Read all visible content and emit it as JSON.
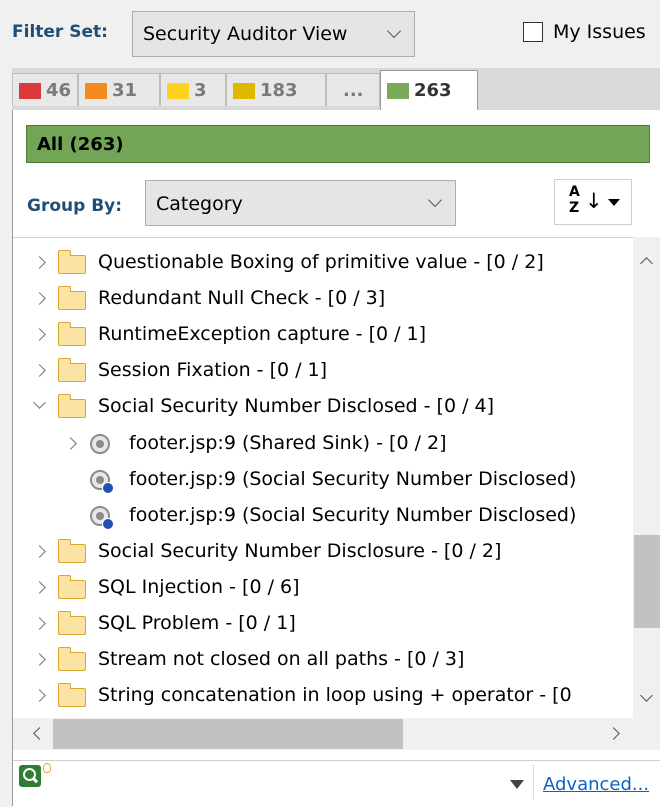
{
  "filter_set": {
    "label": "Filter Set:",
    "value": "Security Auditor View"
  },
  "my_issues": {
    "label": "My Issues",
    "checked": false
  },
  "tabs": [
    {
      "count": "46",
      "color": "#d93b3b"
    },
    {
      "count": "31",
      "color": "#f28c1e"
    },
    {
      "count": "3",
      "color": "#ffd21f"
    },
    {
      "count": "183",
      "color": "#e0b800"
    },
    {
      "count": "..."
    },
    {
      "count": "263",
      "color": "#7aaa5a",
      "active": true
    }
  ],
  "all_bar": {
    "label": "All (263)",
    "color": "#73a557"
  },
  "group_by": {
    "label": "Group By:",
    "value": "Category"
  },
  "sort": {
    "az": "A\nZ",
    "arrow": "↓"
  },
  "tree": [
    {
      "type": "folder",
      "expanded": false,
      "text": "Questionable Boxing of primitive value - [0 / 2]"
    },
    {
      "type": "folder",
      "expanded": false,
      "text": "Redundant Null Check - [0 / 3]"
    },
    {
      "type": "folder",
      "expanded": false,
      "text": "RuntimeException capture - [0 / 1]"
    },
    {
      "type": "folder",
      "expanded": false,
      "text": "Session Fixation - [0 / 1]"
    },
    {
      "type": "folder",
      "expanded": true,
      "text": "Social Security Number Disclosed - [0 / 4]"
    },
    {
      "type": "sink",
      "expanded": false,
      "text": "footer.jsp:9 (Shared Sink) - [0 / 2]"
    },
    {
      "type": "issue",
      "text": "footer.jsp:9 (Social Security Number Disclosed)"
    },
    {
      "type": "issue",
      "text": "footer.jsp:9 (Social Security Number Disclosed)"
    },
    {
      "type": "folder",
      "expanded": false,
      "text": "Social Security Number Disclosure - [0 / 2]"
    },
    {
      "type": "folder",
      "expanded": false,
      "text": "SQL Injection - [0 / 6]"
    },
    {
      "type": "folder",
      "expanded": false,
      "text": "SQL Problem - [0 / 1]"
    },
    {
      "type": "folder",
      "expanded": false,
      "text": "Stream not closed on all paths - [0 / 3]"
    },
    {
      "type": "folder",
      "expanded": false,
      "text": "String concatenation in loop using + operator - [0"
    }
  ],
  "search": {
    "value": "",
    "advanced_label": "Advanced..."
  }
}
